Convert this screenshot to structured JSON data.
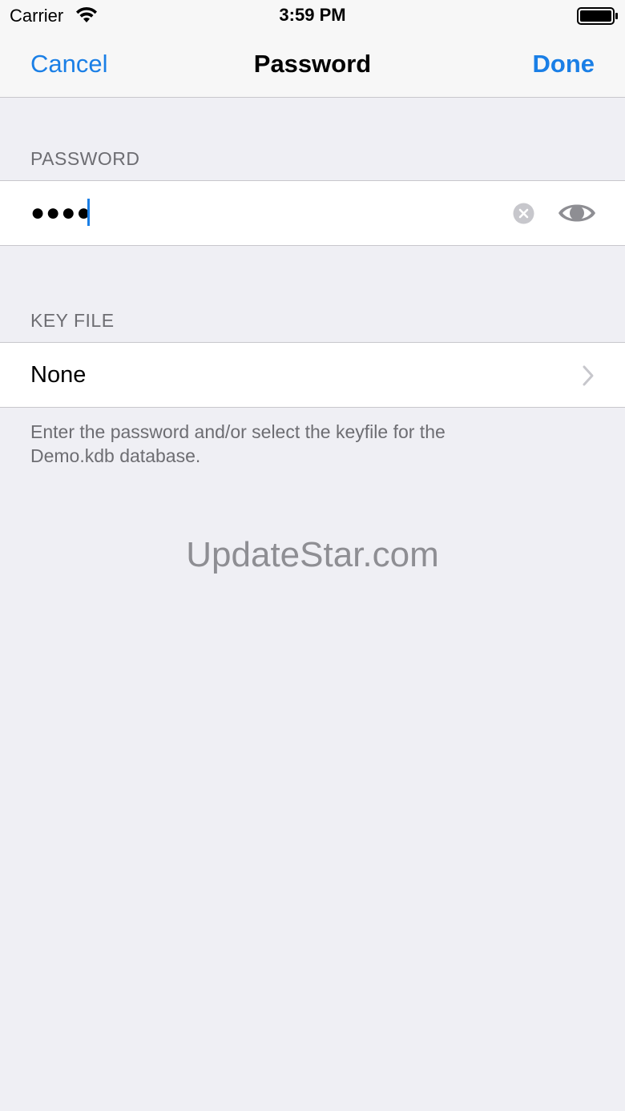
{
  "status_bar": {
    "carrier": "Carrier",
    "time": "3:59 PM"
  },
  "nav": {
    "cancel_label": "Cancel",
    "title": "Password",
    "done_label": "Done"
  },
  "password_section": {
    "header": "PASSWORD",
    "masked_value": "●●●●"
  },
  "keyfile_section": {
    "header": "KEY FILE",
    "value": "None"
  },
  "footer": {
    "text": "Enter the password and/or select the keyfile for the Demo.kdb database."
  },
  "watermark": "UpdateStar.com",
  "icons": {
    "wifi": "wifi-icon",
    "battery": "battery-icon",
    "clear": "clear-icon",
    "eye": "eye-icon",
    "chevron": "chevron-right-icon"
  },
  "colors": {
    "accent": "#1a7fe6",
    "background": "#efeff4",
    "secondary_text": "#6d6d72"
  }
}
